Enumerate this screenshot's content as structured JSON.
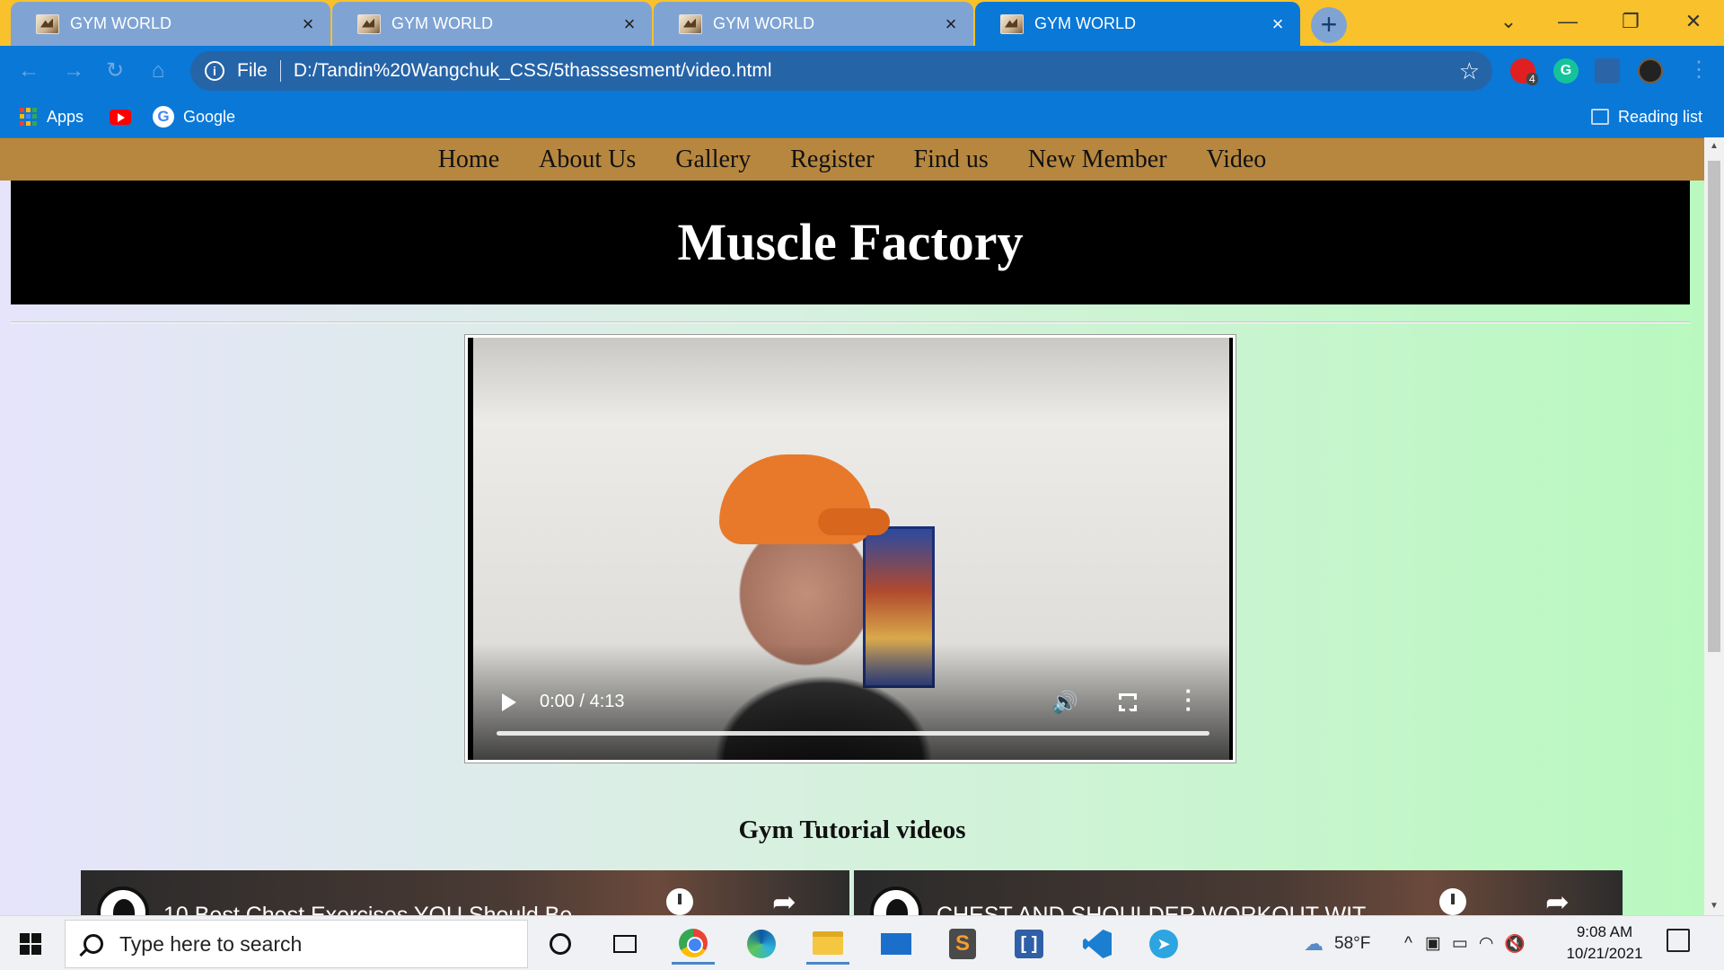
{
  "browser": {
    "tabs": [
      {
        "title": "GYM WORLD",
        "active": false
      },
      {
        "title": "GYM WORLD",
        "active": false
      },
      {
        "title": "GYM WORLD",
        "active": false
      },
      {
        "title": "GYM WORLD",
        "active": true
      }
    ],
    "new_tab_label": "+",
    "window_controls": {
      "menu": "⌄",
      "minimize": "—",
      "restore": "❐",
      "close": "✕"
    },
    "address": {
      "scheme": "File",
      "url": "D:/Tandin%20Wangchuk_CSS/5thasssesment/video.html"
    },
    "extension_badge": "4",
    "bookmarks": [
      {
        "label": "Apps",
        "icon": "apps-grid-icon"
      },
      {
        "label": "",
        "icon": "youtube-icon"
      },
      {
        "label": "Google",
        "icon": "google-icon"
      }
    ],
    "reading_list": "Reading list",
    "accent": "#0a78d7",
    "tabstrip_color": "#f9c12b"
  },
  "page": {
    "nav": [
      "Home",
      "About Us",
      "Gallery",
      "Register",
      "Find us",
      "New Member",
      "Video"
    ],
    "nav_color": "#b7873f",
    "banner_title": "Muscle Factory",
    "video": {
      "time": "0:00 / 4:13",
      "progress": 0
    },
    "section_title": "Gym Tutorial videos",
    "embeds": [
      {
        "title": "10 Best Chest Exercises YOU Should Be"
      },
      {
        "title": "CHEST AND SHOULDER WORKOUT WIT"
      }
    ]
  },
  "taskbar": {
    "search_placeholder": "Type here to search",
    "apps": [
      "cortana-icon",
      "task-view-icon",
      "chrome-icon",
      "edge-icon",
      "file-explorer-icon",
      "mail-icon",
      "sublime-text-icon",
      "brackets-icon",
      "vscode-icon",
      "telegram-icon"
    ],
    "weather": "58°F",
    "time": "9:08 AM",
    "date": "10/21/2021"
  }
}
